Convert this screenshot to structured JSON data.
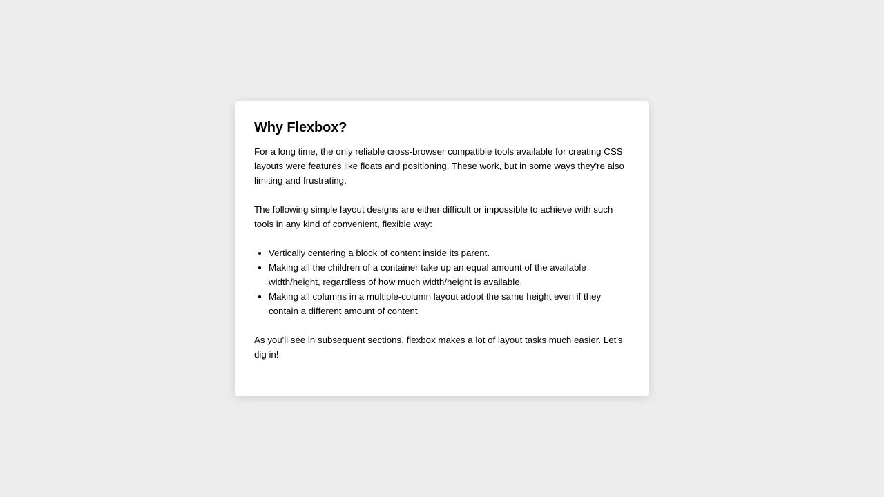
{
  "article": {
    "title": "Why Flexbox?",
    "paragraphs": [
      "For a long time, the only reliable cross-browser compatible tools available for creating CSS layouts were features like floats and positioning. These work, but in some ways they're also limiting and frustrating.",
      "The following simple layout designs are either difficult or impossible to achieve with such tools in any kind of convenient, flexible way:"
    ],
    "bullets": [
      "Vertically centering a block of content inside its parent.",
      "Making all the children of a container take up an equal amount of the available width/height, regardless of how much width/height is available.",
      "Making all columns in a multiple-column layout adopt the same height even if they contain a different amount of content."
    ],
    "closing": "As you'll see in subsequent sections, flexbox makes a lot of layout tasks much easier. Let's dig in!"
  }
}
